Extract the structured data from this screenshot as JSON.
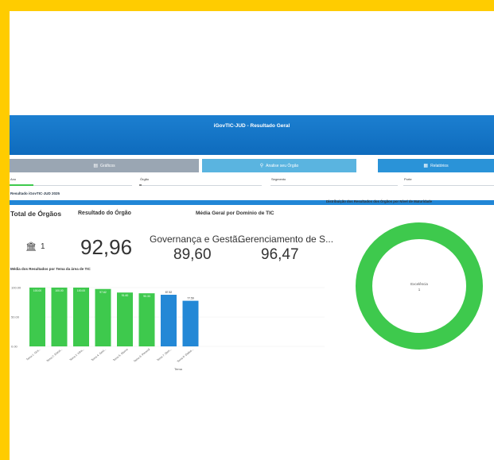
{
  "header": {
    "title": "iGovTIC-JUD - Resultado Geral"
  },
  "nav": [
    {
      "label": "Gráficos",
      "icon": "chart-icon"
    },
    {
      "label": "Analise seu Órgão",
      "icon": "search-icon"
    },
    {
      "label": "Relatórios",
      "icon": "report-icon"
    }
  ],
  "filters": [
    {
      "label": "Ano"
    },
    {
      "label": "Órgão"
    },
    {
      "label": "Segmento"
    },
    {
      "label": "Porte"
    }
  ],
  "subtitle": "Resultado iGovTIC-JUD 2025",
  "kpis": {
    "total_label": "Total de Órgãos",
    "total_value": "1",
    "resultado_label": "Resultado do Órgão",
    "resultado_value": "92,96",
    "media_label": "Média Geral por Domínio de TIC",
    "dominio1_label": "Governança e Gestã...",
    "dominio1_value": "89,60",
    "dominio2_label": "Gerenciamento de S...",
    "dominio2_value": "96,47"
  },
  "colors": {
    "green": "#3ec94d",
    "blue": "#2388d6",
    "header": "#1576c8",
    "nav1": "#9aa6b3",
    "nav2": "#5ab4e0",
    "nav3": "#2a93d8"
  },
  "chart_data": [
    {
      "type": "bar",
      "title": "Média dos Resultados por Tema da área de TIC",
      "xlabel": "Tema",
      "ylabel": "",
      "ylim": [
        0,
        100
      ],
      "yticks": [
        "0.00",
        "50.00",
        "100.00"
      ],
      "categories": [
        "Tema 1: Gov...",
        "Tema 2: Estrat...",
        "Tema 3: Infra...",
        "Tema 4: Gest...",
        "Tema 5: Riscos",
        "Tema 6: Pessoal",
        "Tema 7: Dem...",
        "Tema 8: Dados..."
      ],
      "values": [
        100.0,
        100.0,
        100.0,
        97.62,
        91.6,
        90.33,
        87.82,
        77.59
      ],
      "data_labels": [
        "100.00",
        "100.00",
        "100.00",
        "97.62",
        "91.60",
        "90.33",
        "87.82",
        "77.59"
      ],
      "bar_colors": [
        "green",
        "green",
        "green",
        "green",
        "green",
        "green",
        "blue",
        "blue"
      ]
    },
    {
      "type": "pie",
      "title": "Distribuição dos Resultados dos Órgãos por Nível de Maturidade",
      "labels": [
        "Excelência"
      ],
      "values": [
        1
      ],
      "center_label": "Excelência",
      "center_value": "1"
    }
  ]
}
